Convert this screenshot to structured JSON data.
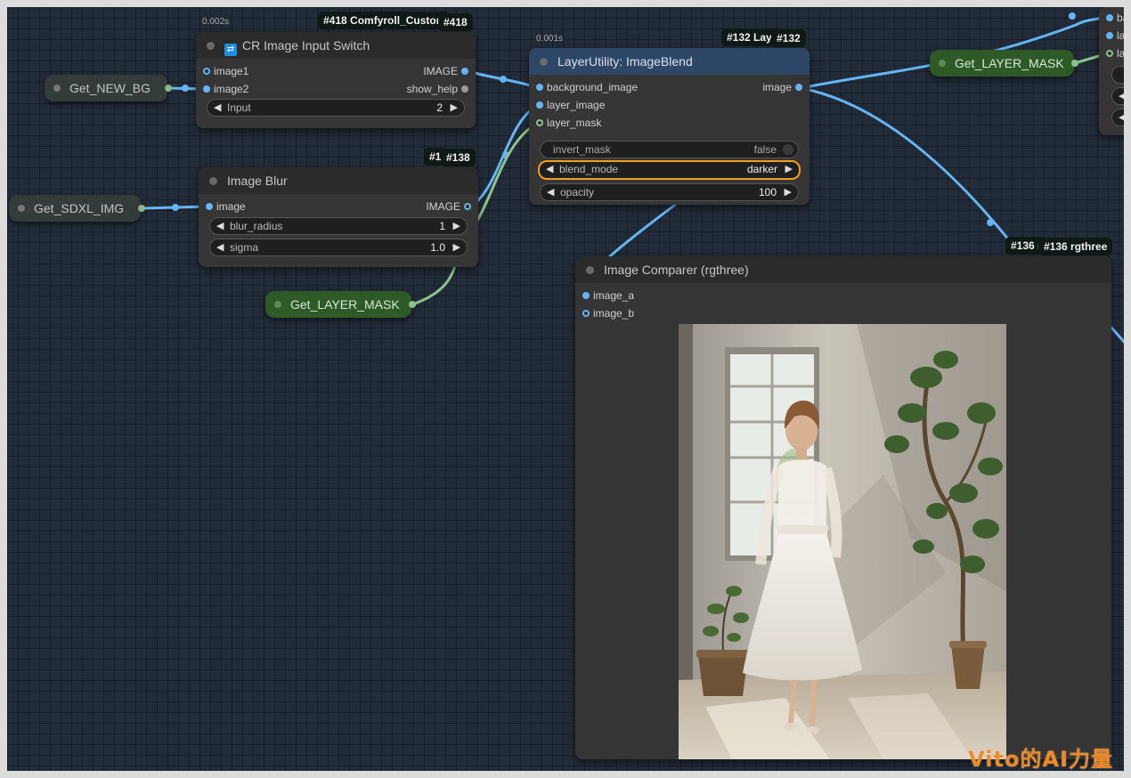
{
  "nodes": {
    "switch": {
      "timing": "0.002s",
      "badge_a": "#418 Comfyroll_Custom",
      "badge_b": "#418",
      "title": "CR Image Input Switch",
      "inputs": [
        "image1",
        "image2"
      ],
      "outputs": [
        "IMAGE",
        "show_help"
      ],
      "widget": {
        "name": "Input",
        "value": "2"
      }
    },
    "blend": {
      "timing": "0.001s",
      "badge_a": "#132 Laye",
      "badge_b": "#132",
      "title": "LayerUtility: ImageBlend",
      "inputs": [
        "background_image",
        "layer_image",
        "layer_mask"
      ],
      "output": "image",
      "widgets": {
        "invert_mask": {
          "name": "invert_mask",
          "value": "false"
        },
        "blend_mode": {
          "name": "blend_mode",
          "value": "darker"
        },
        "opacity": {
          "name": "opacity",
          "value": "100"
        }
      }
    },
    "blur": {
      "badge_a": "#1",
      "badge_b": "#138",
      "title": "Image Blur",
      "input": "image",
      "output": "IMAGE",
      "widgets": {
        "blur_radius": {
          "name": "blur_radius",
          "value": "1"
        },
        "sigma": {
          "name": "sigma",
          "value": "1.0"
        }
      }
    },
    "comparer": {
      "badge_a": "#136 r",
      "badge_b": "#136 rgthree",
      "title": "Image Comparer (rgthree)",
      "inputs": [
        "image_a",
        "image_b"
      ]
    },
    "right_partial": {
      "inputs": [
        "ba",
        "la",
        "la"
      ]
    }
  },
  "get_nodes": {
    "new_bg": "Get_NEW_BG",
    "sdxl_img": "Get_SDXL_IMG",
    "layer_mask_1": "Get_LAYER_MASK",
    "layer_mask_2": "Get_LAYER_MASK"
  },
  "colors": {
    "canvas": "#222b38",
    "image_wire": "#64b5f6",
    "mask_wire": "#8bc48a",
    "highlight": "#f0a020",
    "get_node_green": "#2d5a27"
  },
  "watermark": "Vito的AI力量"
}
